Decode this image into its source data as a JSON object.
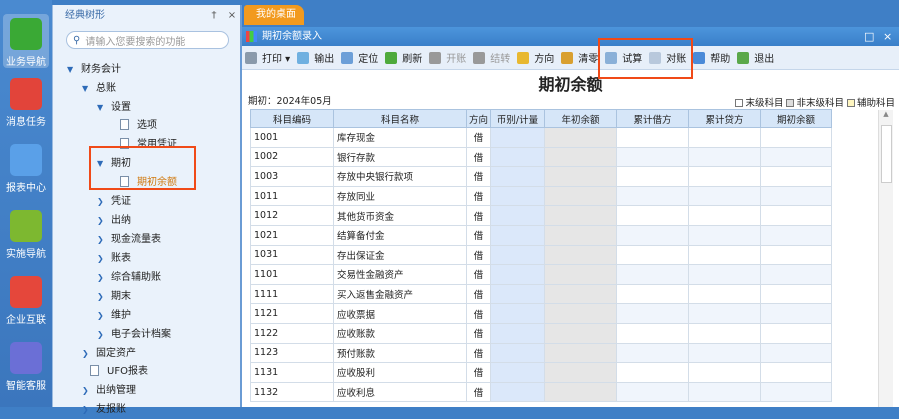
{
  "leftbar": [
    {
      "label": "业务导航",
      "icon": "business-nav-icon",
      "color": "#3aa935"
    },
    {
      "label": "消息任务",
      "icon": "message-icon",
      "color": "#e2443a"
    },
    {
      "label": "报表中心",
      "icon": "report-icon",
      "color": "#5aa0e8"
    },
    {
      "label": "实施导航",
      "icon": "compass-icon",
      "color": "#7db830"
    },
    {
      "label": "企业互联",
      "icon": "connect-icon",
      "color": "#e5473b"
    },
    {
      "label": "智能客服",
      "icon": "service-icon",
      "color": "#6b6fd6"
    }
  ],
  "tree": {
    "title": "经典树形",
    "pin": "†",
    "close": "×",
    "search_placeholder": "请输入您要搜索的功能",
    "items": [
      {
        "label": "财务会计",
        "ar": "▼"
      },
      {
        "label": "总账",
        "ar": "▼"
      },
      {
        "label": "设置",
        "ar": "▼"
      },
      {
        "label": "选项"
      },
      {
        "label": "常用凭证"
      },
      {
        "label": "期初",
        "ar": "▼"
      },
      {
        "label": "期初余额"
      },
      {
        "label": "凭证",
        "ar": "❯"
      },
      {
        "label": "出纳",
        "ar": "❯"
      },
      {
        "label": "现金流量表",
        "ar": "❯"
      },
      {
        "label": "账表",
        "ar": "❯"
      },
      {
        "label": "综合辅助账",
        "ar": "❯"
      },
      {
        "label": "期末",
        "ar": "❯"
      },
      {
        "label": "维护",
        "ar": "❯"
      },
      {
        "label": "电子会计档案",
        "ar": "❯"
      },
      {
        "label": "固定资产",
        "ar": "❯"
      },
      {
        "label": "UFO报表"
      },
      {
        "label": "出纳管理",
        "ar": "❯"
      },
      {
        "label": "友报账",
        "ar": "❯"
      }
    ]
  },
  "tab": "我的桌面",
  "window": {
    "title": "期初余额录入",
    "max": "□",
    "close": "×"
  },
  "toolbar": [
    {
      "label": "打印 ▾",
      "c": "#8a9aab"
    },
    {
      "label": "输出",
      "c": "#6fb0e0"
    },
    {
      "label": "定位",
      "c": "#6c9fd8"
    },
    {
      "label": "刷新",
      "c": "#4eaa3c"
    },
    {
      "label": "开账",
      "c": "#999",
      "dis": true
    },
    {
      "label": "结转",
      "c": "#999",
      "dis": true
    },
    {
      "label": "方向",
      "c": "#e8b830"
    },
    {
      "label": "清零",
      "c": "#d9a030"
    },
    {
      "label": "试算",
      "c": "#8ab0d8"
    },
    {
      "label": "对账",
      "c": "#b8c8dc"
    },
    {
      "label": "帮助",
      "c": "#4a8ad8"
    },
    {
      "label": "退出",
      "c": "#5aa84a"
    }
  ],
  "page_title": "期初余额",
  "period": "期初：2024年05月",
  "legend": [
    {
      "label": "末级科目",
      "c": "#fff"
    },
    {
      "label": "非末级科目",
      "c": "#ddd"
    },
    {
      "label": "辅助科目",
      "c": "#fff6c0"
    }
  ],
  "columns": [
    "科目编码",
    "科目名称",
    "方向",
    "币别/计量",
    "年初余额",
    "累计借方",
    "累计贷方",
    "期初余额"
  ],
  "rows": [
    [
      "1001",
      "库存现金",
      "借"
    ],
    [
      "1002",
      "银行存款",
      "借"
    ],
    [
      "1003",
      "存放中央银行款项",
      "借"
    ],
    [
      "1011",
      "存放同业",
      "借"
    ],
    [
      "1012",
      "其他货币资金",
      "借"
    ],
    [
      "1021",
      "结算备付金",
      "借"
    ],
    [
      "1031",
      "存出保证金",
      "借"
    ],
    [
      "1101",
      "交易性金融资产",
      "借"
    ],
    [
      "1111",
      "买入返售金融资产",
      "借"
    ],
    [
      "1121",
      "应收票据",
      "借"
    ],
    [
      "1122",
      "应收账款",
      "借"
    ],
    [
      "1123",
      "预付账款",
      "借"
    ],
    [
      "1131",
      "应收股利",
      "借"
    ],
    [
      "1132",
      "应收利息",
      "借"
    ]
  ]
}
